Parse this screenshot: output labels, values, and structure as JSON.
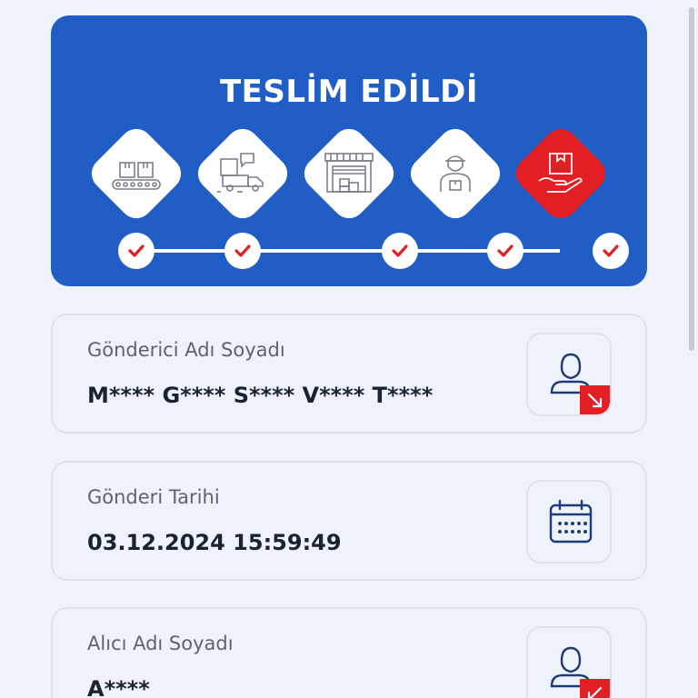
{
  "status": {
    "title": "TESLİM EDİLDİ",
    "steps": [
      {
        "icon": "conveyor-boxes-icon",
        "completed": true
      },
      {
        "icon": "delivery-truck-icon",
        "completed": true
      },
      {
        "icon": "warehouse-icon",
        "completed": true
      },
      {
        "icon": "courier-icon",
        "completed": true
      },
      {
        "icon": "hand-package-icon",
        "completed": true,
        "active": true
      }
    ],
    "colors": {
      "card": "#205dc4",
      "active": "#e31e24",
      "check": "#e31e24"
    }
  },
  "sender": {
    "label": "Gönderici Adı Soyadı",
    "value": "M**** G**** S**** V**** T****",
    "icon": "user-outgoing-icon"
  },
  "date": {
    "label": "Gönderi Tarihi",
    "value": "03.12.2024 15:59:49",
    "icon": "calendar-icon"
  },
  "receiver": {
    "label": "Alıcı Adı Soyadı",
    "value": "A****",
    "icon": "user-incoming-icon"
  }
}
